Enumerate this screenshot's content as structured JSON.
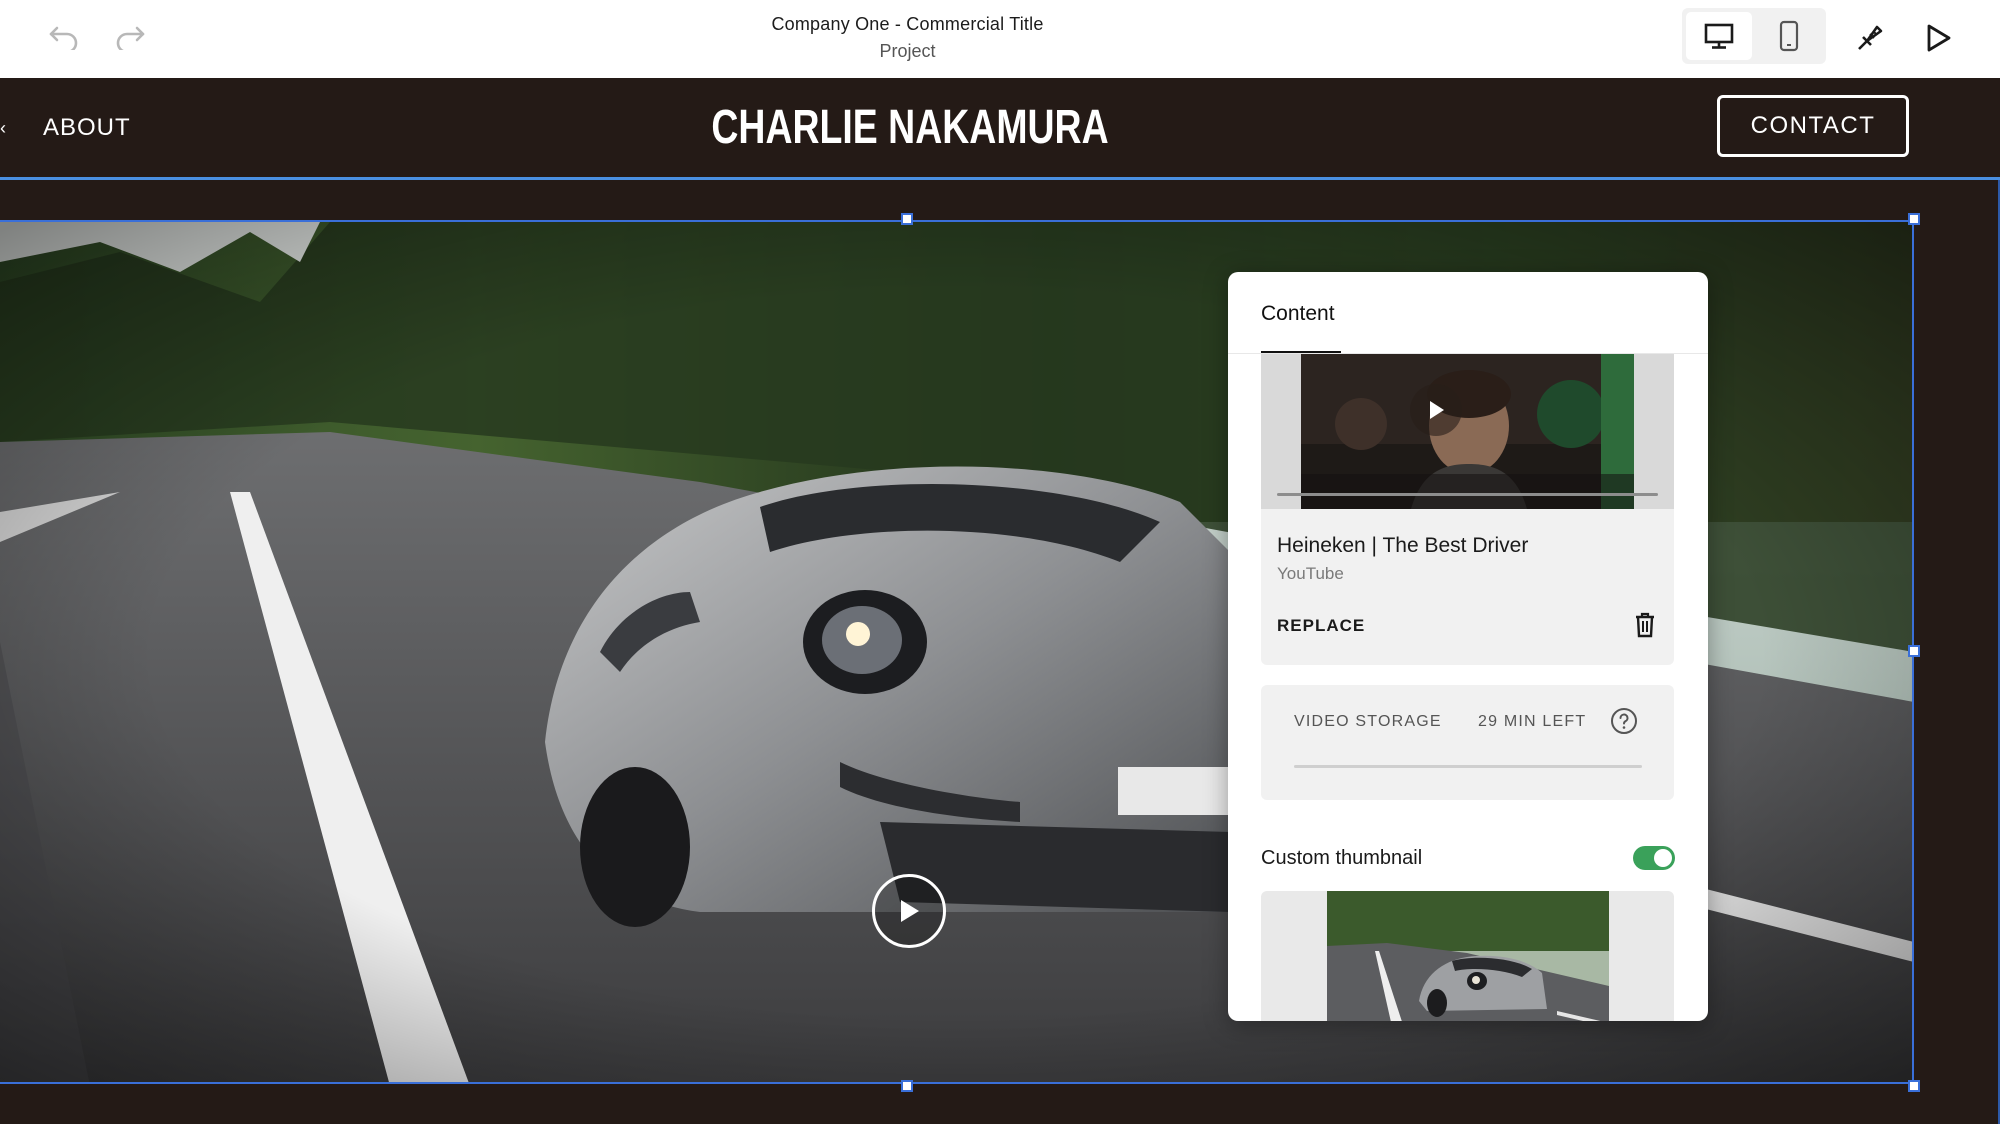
{
  "editor": {
    "title": "Company One - Commercial Title",
    "subtitle": "Project",
    "icons": [
      "undo-icon",
      "redo-icon",
      "desktop-icon",
      "mobile-icon",
      "paintbrush-icon",
      "play-icon"
    ]
  },
  "site": {
    "nav_about": "ABOUT",
    "title": "CHARLIE NAKAMURA",
    "contact": "CONTACT"
  },
  "panel": {
    "tab": "Content",
    "video": {
      "name": "Heineken | The Best Driver",
      "source": "YouTube",
      "replace_label": "REPLACE"
    },
    "storage": {
      "label": "VIDEO STORAGE",
      "remaining": "29 MIN LEFT",
      "used_fraction": 0.0
    },
    "custom_thumbnail": {
      "label": "Custom thumbnail",
      "enabled": true
    }
  },
  "colors": {
    "header_bg": "#241a16",
    "selection": "#3a6fd8",
    "toggle_on": "#3aa15a"
  }
}
